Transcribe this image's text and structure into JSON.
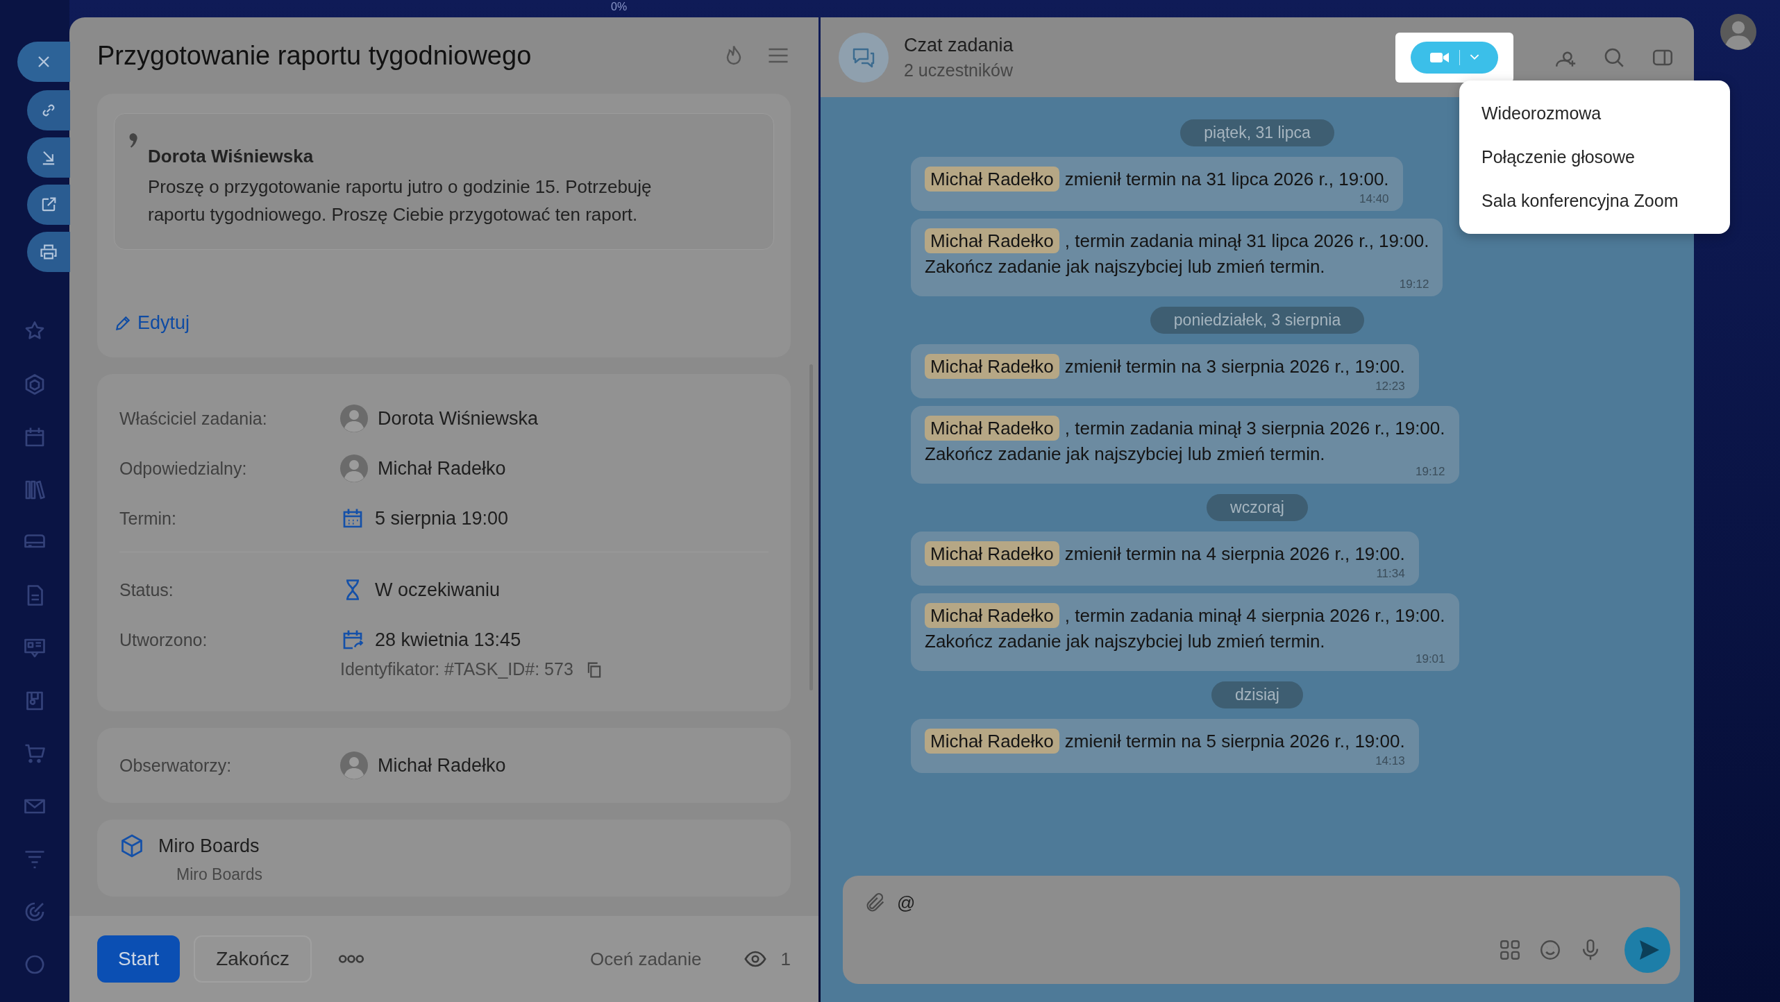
{
  "top_bar": {
    "progress": "0%"
  },
  "task": {
    "title": "Przygotowanie raportu tygodniowego",
    "description": {
      "author": "Dorota Wiśniewska",
      "text": "Proszę o przygotowanie raportu jutro o godzinie 15. Potrzebuję raportu tygodniowego. Proszę Ciebie przygotować ten raport."
    },
    "edit_link": "Edytuj",
    "detail_groups": [
      [
        {
          "label": "Właściciel zadania:",
          "value": "Dorota Wiśniewska",
          "kind": "person"
        },
        {
          "label": "Odpowiedzialny:",
          "value": "Michał Radełko",
          "kind": "person"
        },
        {
          "label": "Termin:",
          "value": "5 sierpnia 19:00",
          "kind": "deadline"
        }
      ],
      [
        {
          "label": "Status:",
          "value": "W oczekiwaniu",
          "kind": "status"
        },
        {
          "label": "Utworzono:",
          "value": "28 kwietnia 13:45",
          "kind": "created",
          "note": "Identyfikator: #TASK_ID#: 573"
        }
      ]
    ],
    "observers": {
      "label": "Obserwatorzy:",
      "value": "Michał Radełko"
    },
    "app": {
      "title": "Miro Boards",
      "subtitle": "Miro Boards"
    },
    "footer": {
      "buttons": [
        {
          "label": "Start",
          "kind": "primary"
        },
        {
          "label": "Zakończ",
          "kind": "secondary"
        }
      ],
      "rate": "Oceń zadanie",
      "views": "1"
    }
  },
  "chat": {
    "title": "Czat zadania",
    "subtitle": "2 uczestników",
    "call_menu": [
      "Wideorozmowa",
      "Połączenie głosowe",
      "Sala konferencyjna Zoom"
    ],
    "messages": [
      {
        "kind": "date",
        "text": "piątek, 31 lipca"
      },
      {
        "kind": "message",
        "author": "Michał Radełko",
        "text": "zmienił termin na 31 lipca 2026 r., 19:00.",
        "time": "14:40"
      },
      {
        "kind": "message",
        "author": "Michał Radełko",
        "text": ", termin zadania minął 31 lipca 2026 r., 19:00.",
        "continuation": "Zakończ zadanie jak najszybciej lub zmień termin.",
        "time": "19:12"
      },
      {
        "kind": "date",
        "text": "poniedziałek, 3 sierpnia"
      },
      {
        "kind": "message",
        "author": "Michał Radełko",
        "text": "zmienił termin na 3 sierpnia 2026 r., 19:00.",
        "time": "12:23"
      },
      {
        "kind": "message",
        "author": "Michał Radełko",
        "text": ", termin zadania minął 3 sierpnia 2026 r., 19:00.",
        "continuation": "Zakończ zadanie jak najszybciej lub zmień termin.",
        "time": "19:12"
      },
      {
        "kind": "date",
        "text": "wczoraj"
      },
      {
        "kind": "message",
        "author": "Michał Radełko",
        "text": "zmienił termin na 4 sierpnia 2026 r., 19:00.",
        "time": "11:34"
      },
      {
        "kind": "message",
        "author": "Michał Radełko",
        "text": ", termin zadania minął 4 sierpnia 2026 r., 19:00.",
        "continuation": "Zakończ zadanie jak najszybciej lub zmień termin.",
        "time": "19:01"
      },
      {
        "kind": "date",
        "text": "dzisiaj"
      },
      {
        "kind": "message",
        "author": "Michał Radełko",
        "text": "zmienił termin na 5 sierpnia 2026 r., 19:00.",
        "time": "14:13"
      }
    ],
    "composer": {
      "value": "@"
    }
  }
}
